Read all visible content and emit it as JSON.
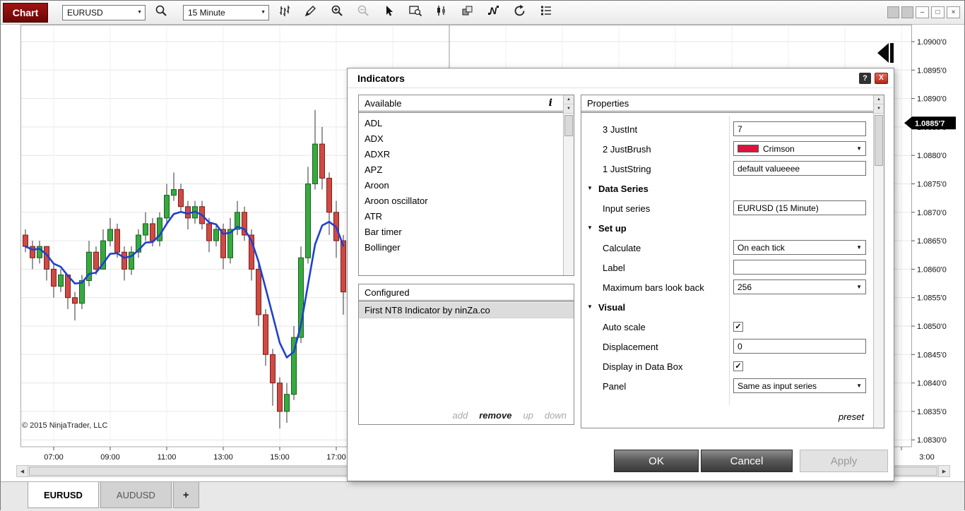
{
  "glyphs": {
    "up": "▲",
    "down": "▼",
    "left": "◀",
    "right": "▶",
    "check": "✓",
    "minimize": "–",
    "maximize": "□",
    "close_window": "×"
  },
  "window": {
    "title_badge": "Chart",
    "instrument": "EURUSD",
    "interval": "15 Minute",
    "copyright": "© 2015 NinjaTrader, LLC",
    "tabs": [
      {
        "label": "EURUSD",
        "active": true
      },
      {
        "label": "AUDUSD",
        "active": false
      },
      {
        "label": "+",
        "active": false
      }
    ]
  },
  "dialog": {
    "title": "Indicators",
    "help_label": "?",
    "close_label": "X",
    "available": {
      "header": "Available",
      "info_icon": "i",
      "items": [
        "ADL",
        "ADX",
        "ADXR",
        "APZ",
        "Aroon",
        "Aroon oscillator",
        "ATR",
        "Bar timer",
        "Bollinger"
      ]
    },
    "configured": {
      "header": "Configured",
      "items": [
        "First NT8 Indicator by ninZa.co"
      ],
      "selected_index": 0,
      "actions": [
        {
          "label": "add",
          "enabled": false
        },
        {
          "label": "remove",
          "enabled": true
        },
        {
          "label": "up",
          "enabled": false
        },
        {
          "label": "down",
          "enabled": false
        }
      ]
    },
    "properties": {
      "header": "Properties",
      "rows": [
        {
          "type": "text",
          "label": "3 JustInt",
          "value": "7"
        },
        {
          "type": "color-select",
          "label": "2 JustBrush",
          "value": "Crimson",
          "swatch": "#DC143C"
        },
        {
          "type": "text",
          "label": "1 JustString",
          "value": "default valueeee"
        },
        {
          "type": "section",
          "label": "Data Series"
        },
        {
          "type": "text",
          "label": "Input series",
          "value": "EURUSD (15 Minute)"
        },
        {
          "type": "section",
          "label": "Set up"
        },
        {
          "type": "select",
          "label": "Calculate",
          "value": "On each tick"
        },
        {
          "type": "text",
          "label": "Label",
          "value": ""
        },
        {
          "type": "select",
          "label": "Maximum bars look back",
          "value": "256"
        },
        {
          "type": "section",
          "label": "Visual"
        },
        {
          "type": "checkbox",
          "label": "Auto scale",
          "checked": true
        },
        {
          "type": "text",
          "label": "Displacement",
          "value": "0"
        },
        {
          "type": "checkbox",
          "label": "Display in Data Box",
          "checked": true
        },
        {
          "type": "select",
          "label": "Panel",
          "value": "Same as input series"
        }
      ],
      "preset_label": "preset"
    },
    "buttons": [
      {
        "label": "OK",
        "enabled": true
      },
      {
        "label": "Cancel",
        "enabled": true
      },
      {
        "label": "Apply",
        "enabled": false
      }
    ]
  },
  "chart_data": {
    "type": "candlestick",
    "title": "EURUSD 15 Minute",
    "price_axis": {
      "min": 1.083,
      "max": 1.09,
      "step": 0.0005,
      "labels": [
        "1.0900'0",
        "1.0895'0",
        "1.0890'0",
        "1.0885'0",
        "1.0880'0",
        "1.0875'0",
        "1.0870'0",
        "1.0865'0",
        "1.0860'0",
        "1.0855'0",
        "1.0850'0",
        "1.0845'0",
        "1.0840'0",
        "1.0835'0",
        "1.0830'0"
      ],
      "current_price": 1.08857,
      "current_price_label": "1.0885'7"
    },
    "time_axis": {
      "labels": [
        "07:00",
        "09:00",
        "11:00",
        "13:00",
        "15:00",
        "17:00"
      ],
      "far_label": "3:00"
    },
    "colors": {
      "up": "#37a93f",
      "up_border": "#14611f",
      "down": "#cf4a44",
      "down_border": "#7d1f1b",
      "wick": "#333333",
      "overlay_line": "#2040cf",
      "grid": "#e6e6e6",
      "session": "#9a9a9a"
    },
    "overlay": "blue moving-average line",
    "candles": [
      {
        "time": "06:00",
        "ohlc": [
          1.0866,
          1.0867,
          1.0863,
          1.0864
        ]
      },
      {
        "time": "06:15",
        "ohlc": [
          1.0864,
          1.0865,
          1.086,
          1.0862
        ]
      },
      {
        "time": "06:30",
        "ohlc": [
          1.0862,
          1.0865,
          1.0861,
          1.0864
        ]
      },
      {
        "time": "06:45",
        "ohlc": [
          1.0864,
          1.0864,
          1.0858,
          1.086
        ]
      },
      {
        "time": "07:00",
        "ohlc": [
          1.086,
          1.0861,
          1.0855,
          1.0857
        ]
      },
      {
        "time": "07:15",
        "ohlc": [
          1.0857,
          1.086,
          1.0856,
          1.0859
        ]
      },
      {
        "time": "07:30",
        "ohlc": [
          1.0859,
          1.0859,
          1.0853,
          1.0855
        ]
      },
      {
        "time": "07:45",
        "ohlc": [
          1.0855,
          1.0856,
          1.0851,
          1.0854
        ]
      },
      {
        "time": "08:00",
        "ohlc": [
          1.0854,
          1.0859,
          1.0853,
          1.0858
        ]
      },
      {
        "time": "08:15",
        "ohlc": [
          1.0858,
          1.0865,
          1.0857,
          1.0863
        ]
      },
      {
        "time": "08:30",
        "ohlc": [
          1.0863,
          1.0864,
          1.0859,
          1.086
        ]
      },
      {
        "time": "08:45",
        "ohlc": [
          1.086,
          1.0867,
          1.086,
          1.0865
        ]
      },
      {
        "time": "09:00",
        "ohlc": [
          1.0865,
          1.0869,
          1.0864,
          1.0867
        ]
      },
      {
        "time": "09:15",
        "ohlc": [
          1.0867,
          1.0868,
          1.0862,
          1.0863
        ]
      },
      {
        "time": "09:30",
        "ohlc": [
          1.0863,
          1.0864,
          1.0858,
          1.086
        ]
      },
      {
        "time": "09:45",
        "ohlc": [
          1.086,
          1.0864,
          1.0859,
          1.0863
        ]
      },
      {
        "time": "10:00",
        "ohlc": [
          1.0863,
          1.0867,
          1.0862,
          1.0866
        ]
      },
      {
        "time": "10:15",
        "ohlc": [
          1.0866,
          1.087,
          1.0865,
          1.0868
        ]
      },
      {
        "time": "10:30",
        "ohlc": [
          1.0868,
          1.0869,
          1.0864,
          1.0865
        ]
      },
      {
        "time": "10:45",
        "ohlc": [
          1.0865,
          1.087,
          1.0864,
          1.0869
        ]
      },
      {
        "time": "11:00",
        "ohlc": [
          1.0869,
          1.0875,
          1.0868,
          1.0873
        ]
      },
      {
        "time": "11:15",
        "ohlc": [
          1.0873,
          1.0877,
          1.0872,
          1.0874
        ]
      },
      {
        "time": "11:30",
        "ohlc": [
          1.0874,
          1.0875,
          1.087,
          1.0871
        ]
      },
      {
        "time": "11:45",
        "ohlc": [
          1.0871,
          1.0872,
          1.0867,
          1.0869
        ]
      },
      {
        "time": "12:00",
        "ohlc": [
          1.0869,
          1.0872,
          1.0868,
          1.0871
        ]
      },
      {
        "time": "12:15",
        "ohlc": [
          1.0871,
          1.0872,
          1.0867,
          1.0868
        ]
      },
      {
        "time": "12:30",
        "ohlc": [
          1.0868,
          1.0869,
          1.0863,
          1.0865
        ]
      },
      {
        "time": "12:45",
        "ohlc": [
          1.0865,
          1.0868,
          1.0864,
          1.0867
        ]
      },
      {
        "time": "13:00",
        "ohlc": [
          1.0867,
          1.0868,
          1.086,
          1.0862
        ]
      },
      {
        "time": "13:15",
        "ohlc": [
          1.0862,
          1.0869,
          1.0861,
          1.0867
        ]
      },
      {
        "time": "13:30",
        "ohlc": [
          1.0867,
          1.0872,
          1.0866,
          1.087
        ]
      },
      {
        "time": "13:45",
        "ohlc": [
          1.087,
          1.0871,
          1.0865,
          1.0866
        ]
      },
      {
        "time": "14:00",
        "ohlc": [
          1.0866,
          1.0867,
          1.0858,
          1.086
        ]
      },
      {
        "time": "14:15",
        "ohlc": [
          1.086,
          1.0861,
          1.085,
          1.0852
        ]
      },
      {
        "time": "14:30",
        "ohlc": [
          1.0852,
          1.0853,
          1.0843,
          1.0845
        ]
      },
      {
        "time": "14:45",
        "ohlc": [
          1.0845,
          1.0846,
          1.0836,
          1.084
        ]
      },
      {
        "time": "15:00",
        "ohlc": [
          1.084,
          1.0841,
          1.0832,
          1.0835
        ]
      },
      {
        "time": "15:15",
        "ohlc": [
          1.0835,
          1.084,
          1.0833,
          1.0838
        ]
      },
      {
        "time": "15:30",
        "ohlc": [
          1.0838,
          1.085,
          1.0837,
          1.0848
        ]
      },
      {
        "time": "15:45",
        "ohlc": [
          1.0848,
          1.0864,
          1.0847,
          1.0862
        ]
      },
      {
        "time": "16:00",
        "ohlc": [
          1.0862,
          1.0878,
          1.0861,
          1.0875
        ]
      },
      {
        "time": "16:15",
        "ohlc": [
          1.0875,
          1.0888,
          1.0874,
          1.0882
        ]
      },
      {
        "time": "16:30",
        "ohlc": [
          1.0882,
          1.0885,
          1.0874,
          1.0876
        ]
      },
      {
        "time": "16:45",
        "ohlc": [
          1.0876,
          1.0877,
          1.0866,
          1.087
        ]
      },
      {
        "time": "17:00",
        "ohlc": [
          1.087,
          1.0872,
          1.0862,
          1.0865
        ]
      },
      {
        "time": "17:15",
        "ohlc": [
          1.0865,
          1.0866,
          1.0852,
          1.0856
        ]
      }
    ]
  }
}
